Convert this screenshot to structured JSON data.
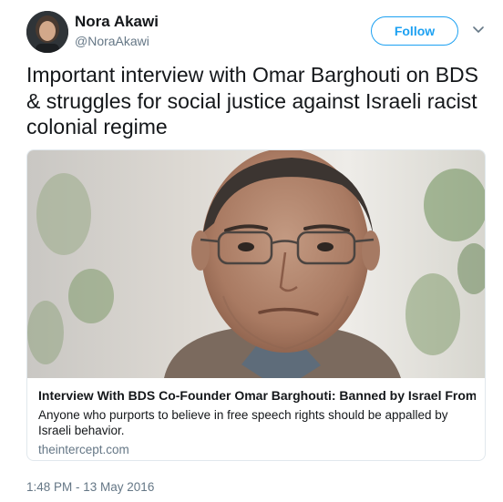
{
  "user": {
    "name": "Nora Akawi",
    "handle": "@NoraAkawi",
    "follow_label": "Follow"
  },
  "tweet": {
    "text": "Important interview with Omar Barghouti on BDS & struggles for social justice against Israeli racist colonial regime",
    "timestamp": "1:48 PM - 13 May 2016"
  },
  "card": {
    "title": "Interview With BDS Co-Founder Omar Barghouti: Banned by Israel From Trav...",
    "description": "Anyone who purports to believe in free speech rights should be appalled by Israeli behavior.",
    "domain": "theintercept.com"
  },
  "colors": {
    "accent": "#1da1f2",
    "secondary_text": "#657786",
    "border": "#e1e8ed"
  },
  "icons": {
    "more": "chevron-down-icon"
  }
}
